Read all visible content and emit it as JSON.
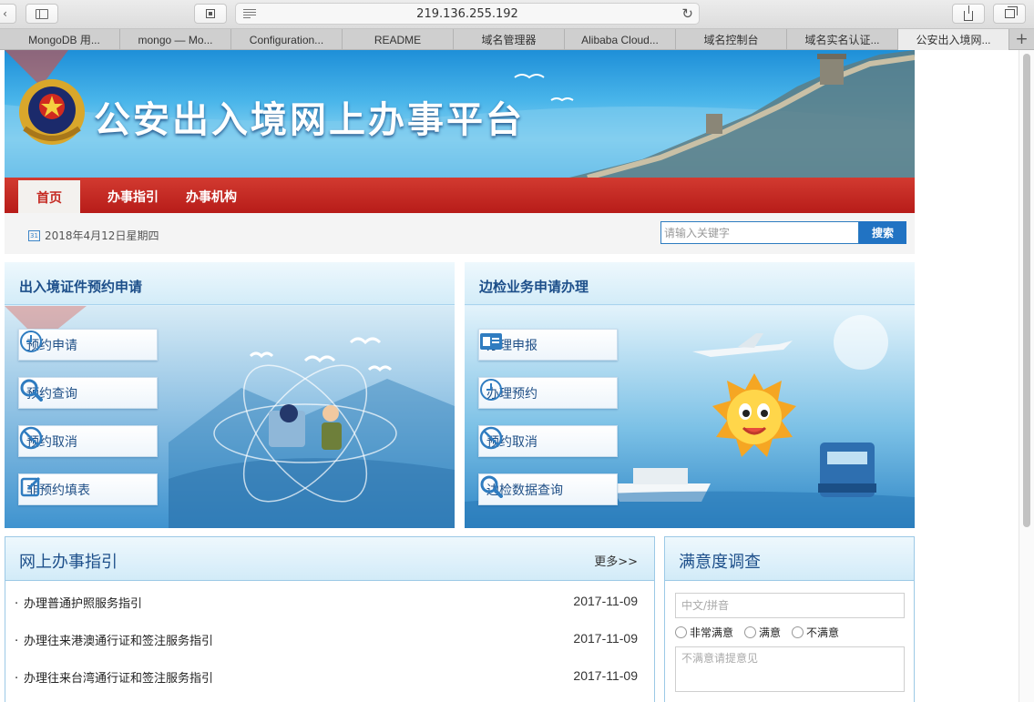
{
  "browser": {
    "address": "219.136.255.192",
    "tabs": [
      "MongoDB 用...",
      "mongo — Mo...",
      "Configuration...",
      "README",
      "域名管理器",
      "Alibaba Cloud...",
      "域名控制台",
      "域名实名认证...",
      "公安出入境网..."
    ],
    "active_tab_index": 8
  },
  "header": {
    "title": "公安出入境网上办事平台"
  },
  "nav": {
    "items": [
      "首页",
      "办事指引",
      "办事机构"
    ]
  },
  "infobar": {
    "date": "2018年4月12日星期四",
    "search_placeholder": "请输入关键字",
    "search_button": "搜索"
  },
  "panel_left": {
    "title": "出入境证件预约申请",
    "buttons": [
      {
        "label": "预约申请",
        "icon": "clock-icon"
      },
      {
        "label": "预约查询",
        "icon": "search-icon"
      },
      {
        "label": "预约取消",
        "icon": "cancel-icon"
      },
      {
        "label": "非预约填表",
        "icon": "edit-icon"
      }
    ]
  },
  "panel_right": {
    "title": "边检业务申请办理",
    "buttons": [
      {
        "label": "办理申报",
        "icon": "id-card-icon"
      },
      {
        "label": "办理预约",
        "icon": "clock-icon"
      },
      {
        "label": "预约取消",
        "icon": "cancel-icon"
      },
      {
        "label": "边检数据查询",
        "icon": "search-icon"
      }
    ]
  },
  "guide": {
    "title": "网上办事指引",
    "more": "更多>>",
    "items": [
      {
        "title": "办理普通护照服务指引",
        "date": "2017-11-09"
      },
      {
        "title": "办理往来港澳通行证和签注服务指引",
        "date": "2017-11-09"
      },
      {
        "title": "办理往来台湾通行证和签注服务指引",
        "date": "2017-11-09"
      }
    ]
  },
  "survey": {
    "title": "满意度调查",
    "name_placeholder": "中文/拼音",
    "options": [
      "非常满意",
      "满意",
      "不满意"
    ],
    "comment_placeholder": "不满意请提意见"
  },
  "colors": {
    "nav_red": "#c52a22",
    "brand_blue": "#2173c3",
    "title_blue": "#1d4f8a"
  }
}
